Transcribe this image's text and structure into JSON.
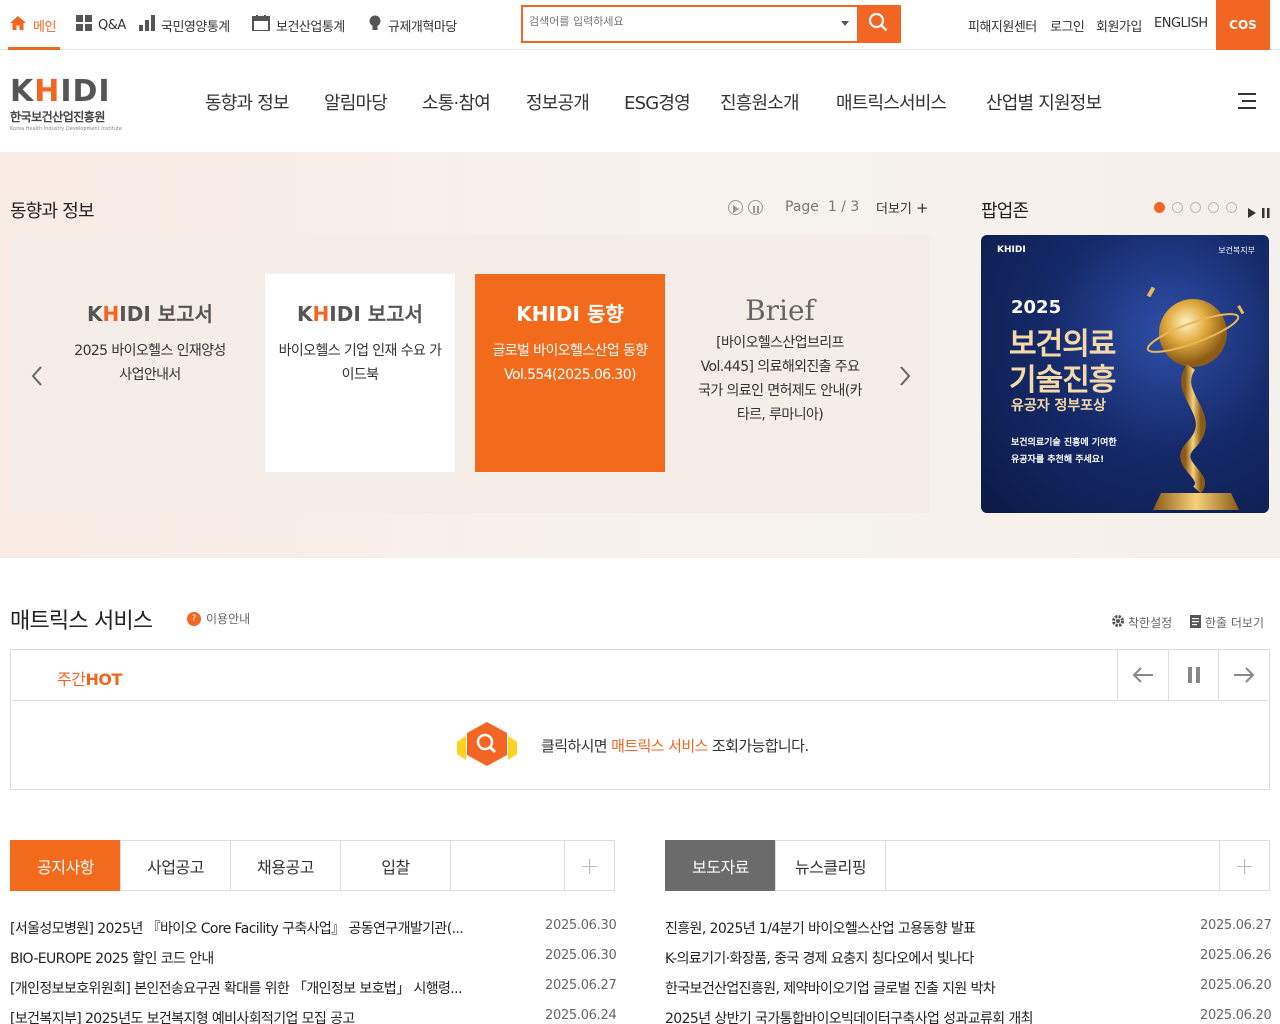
{
  "utility": {
    "items": [
      {
        "label": "메인",
        "icon": "home-icon"
      },
      {
        "label": "Q&A",
        "icon": "grid-icon"
      },
      {
        "label": "국민영양통계",
        "icon": "bar-chart-icon"
      },
      {
        "label": "보건산업통계",
        "icon": "calendar-icon"
      },
      {
        "label": "규제개혁마당",
        "icon": "lightbulb-icon"
      }
    ],
    "search_placeholder": "검색어를 입력하세요",
    "links": [
      "피해지원센터",
      "로그인",
      "회원가입",
      "ENGLISH"
    ],
    "cos_label": "COS"
  },
  "header": {
    "logo_text": "KHIDI",
    "logo_korean": "한국보건산업진흥원",
    "logo_english": "Korea Health Industry Development Institute",
    "nav": [
      "동향과 정보",
      "알림마당",
      "소통·참여",
      "정보공개",
      "ESG경영",
      "진흥원소개",
      "매트릭스서비스",
      "산업별 지원정보"
    ]
  },
  "trend": {
    "title": "동향과 정보",
    "page_label": "Page",
    "page_value": "1 / 3",
    "more_label": "더보기",
    "cards": [
      {
        "tag_brand": "KHIDI",
        "tag_word": "보고서",
        "title": "2025 바이오헬스 인재양성 사업안내서"
      },
      {
        "tag_brand": "KHIDI",
        "tag_word": "보고서",
        "title": "바이오헬스 기업 인재 수요 가이드북"
      },
      {
        "tag_brand": "KHIDI",
        "tag_word": "동향",
        "title": "글로벌 바이오헬스산업 동향 Vol.554(2025.06.30)"
      },
      {
        "tag_word": "Brief",
        "title": "[바이오헬스산업브리프 Vol.445] 의료해외진출 주요국가 의료인 면허제도 안내(카타르, 루마니아)"
      }
    ]
  },
  "popup": {
    "title": "팝업존",
    "logo": "KHIDI",
    "ministry": "보건복지부",
    "year": "2025",
    "line1": "보건의료",
    "line2": "기술진흥",
    "line3": "유공자 정부포상",
    "line4": "보건의료기술 진흥에 기여한",
    "line5": "유공자를 추천해 주세요!"
  },
  "matrix": {
    "title": "매트릭스 서비스",
    "info_label": "이용안내",
    "setting_label": "착한설정",
    "more_label": "한줄 더보기",
    "hot_prefix": "주간",
    "hot_word": "HOT",
    "msg_before": "클릭하시면 ",
    "msg_highlight": "매트릭스 서비스",
    "msg_after": " 조회가능합니다."
  },
  "board_left": {
    "tabs": [
      "공지사항",
      "사업공고",
      "채용공고",
      "입찰"
    ],
    "rows": [
      {
        "title": "[서울성모병원] 2025년 『바이오 Core Facility 구축사업』 공동연구개발기관(...",
        "date": "2025.06.30"
      },
      {
        "title": "BIO-EUROPE 2025 할인 코드 안내",
        "date": "2025.06.30"
      },
      {
        "title": "[개인정보보호위원회] 본인전송요구권 확대를 위한 「개인정보 보호법」 시행령...",
        "date": "2025.06.27"
      },
      {
        "title": "[보건복지부] 2025년도 보건복지형 예비사회적기업 모집 공고",
        "date": "2025.06.24"
      }
    ]
  },
  "board_right": {
    "tabs": [
      "보도자료",
      "뉴스클리핑"
    ],
    "rows": [
      {
        "title": "진흥원, 2025년 1/4분기 바이오헬스산업 고용동향 발표",
        "date": "2025.06.27"
      },
      {
        "title": "K-의료기기·화장품, 중국 경제 요충지 칭다오에서 빛나다",
        "date": "2025.06.26"
      },
      {
        "title": "한국보건산업진흥원, 제약바이오기업 글로벌 진출 지원 박차",
        "date": "2025.06.20"
      },
      {
        "title": "2025년 상반기 국가통합바이오빅데이터구축사업 성과교류회 개최",
        "date": "2025.06.20"
      }
    ]
  },
  "colors": {
    "accent": "#f26522",
    "tab_gray": "#6b6b6b"
  }
}
